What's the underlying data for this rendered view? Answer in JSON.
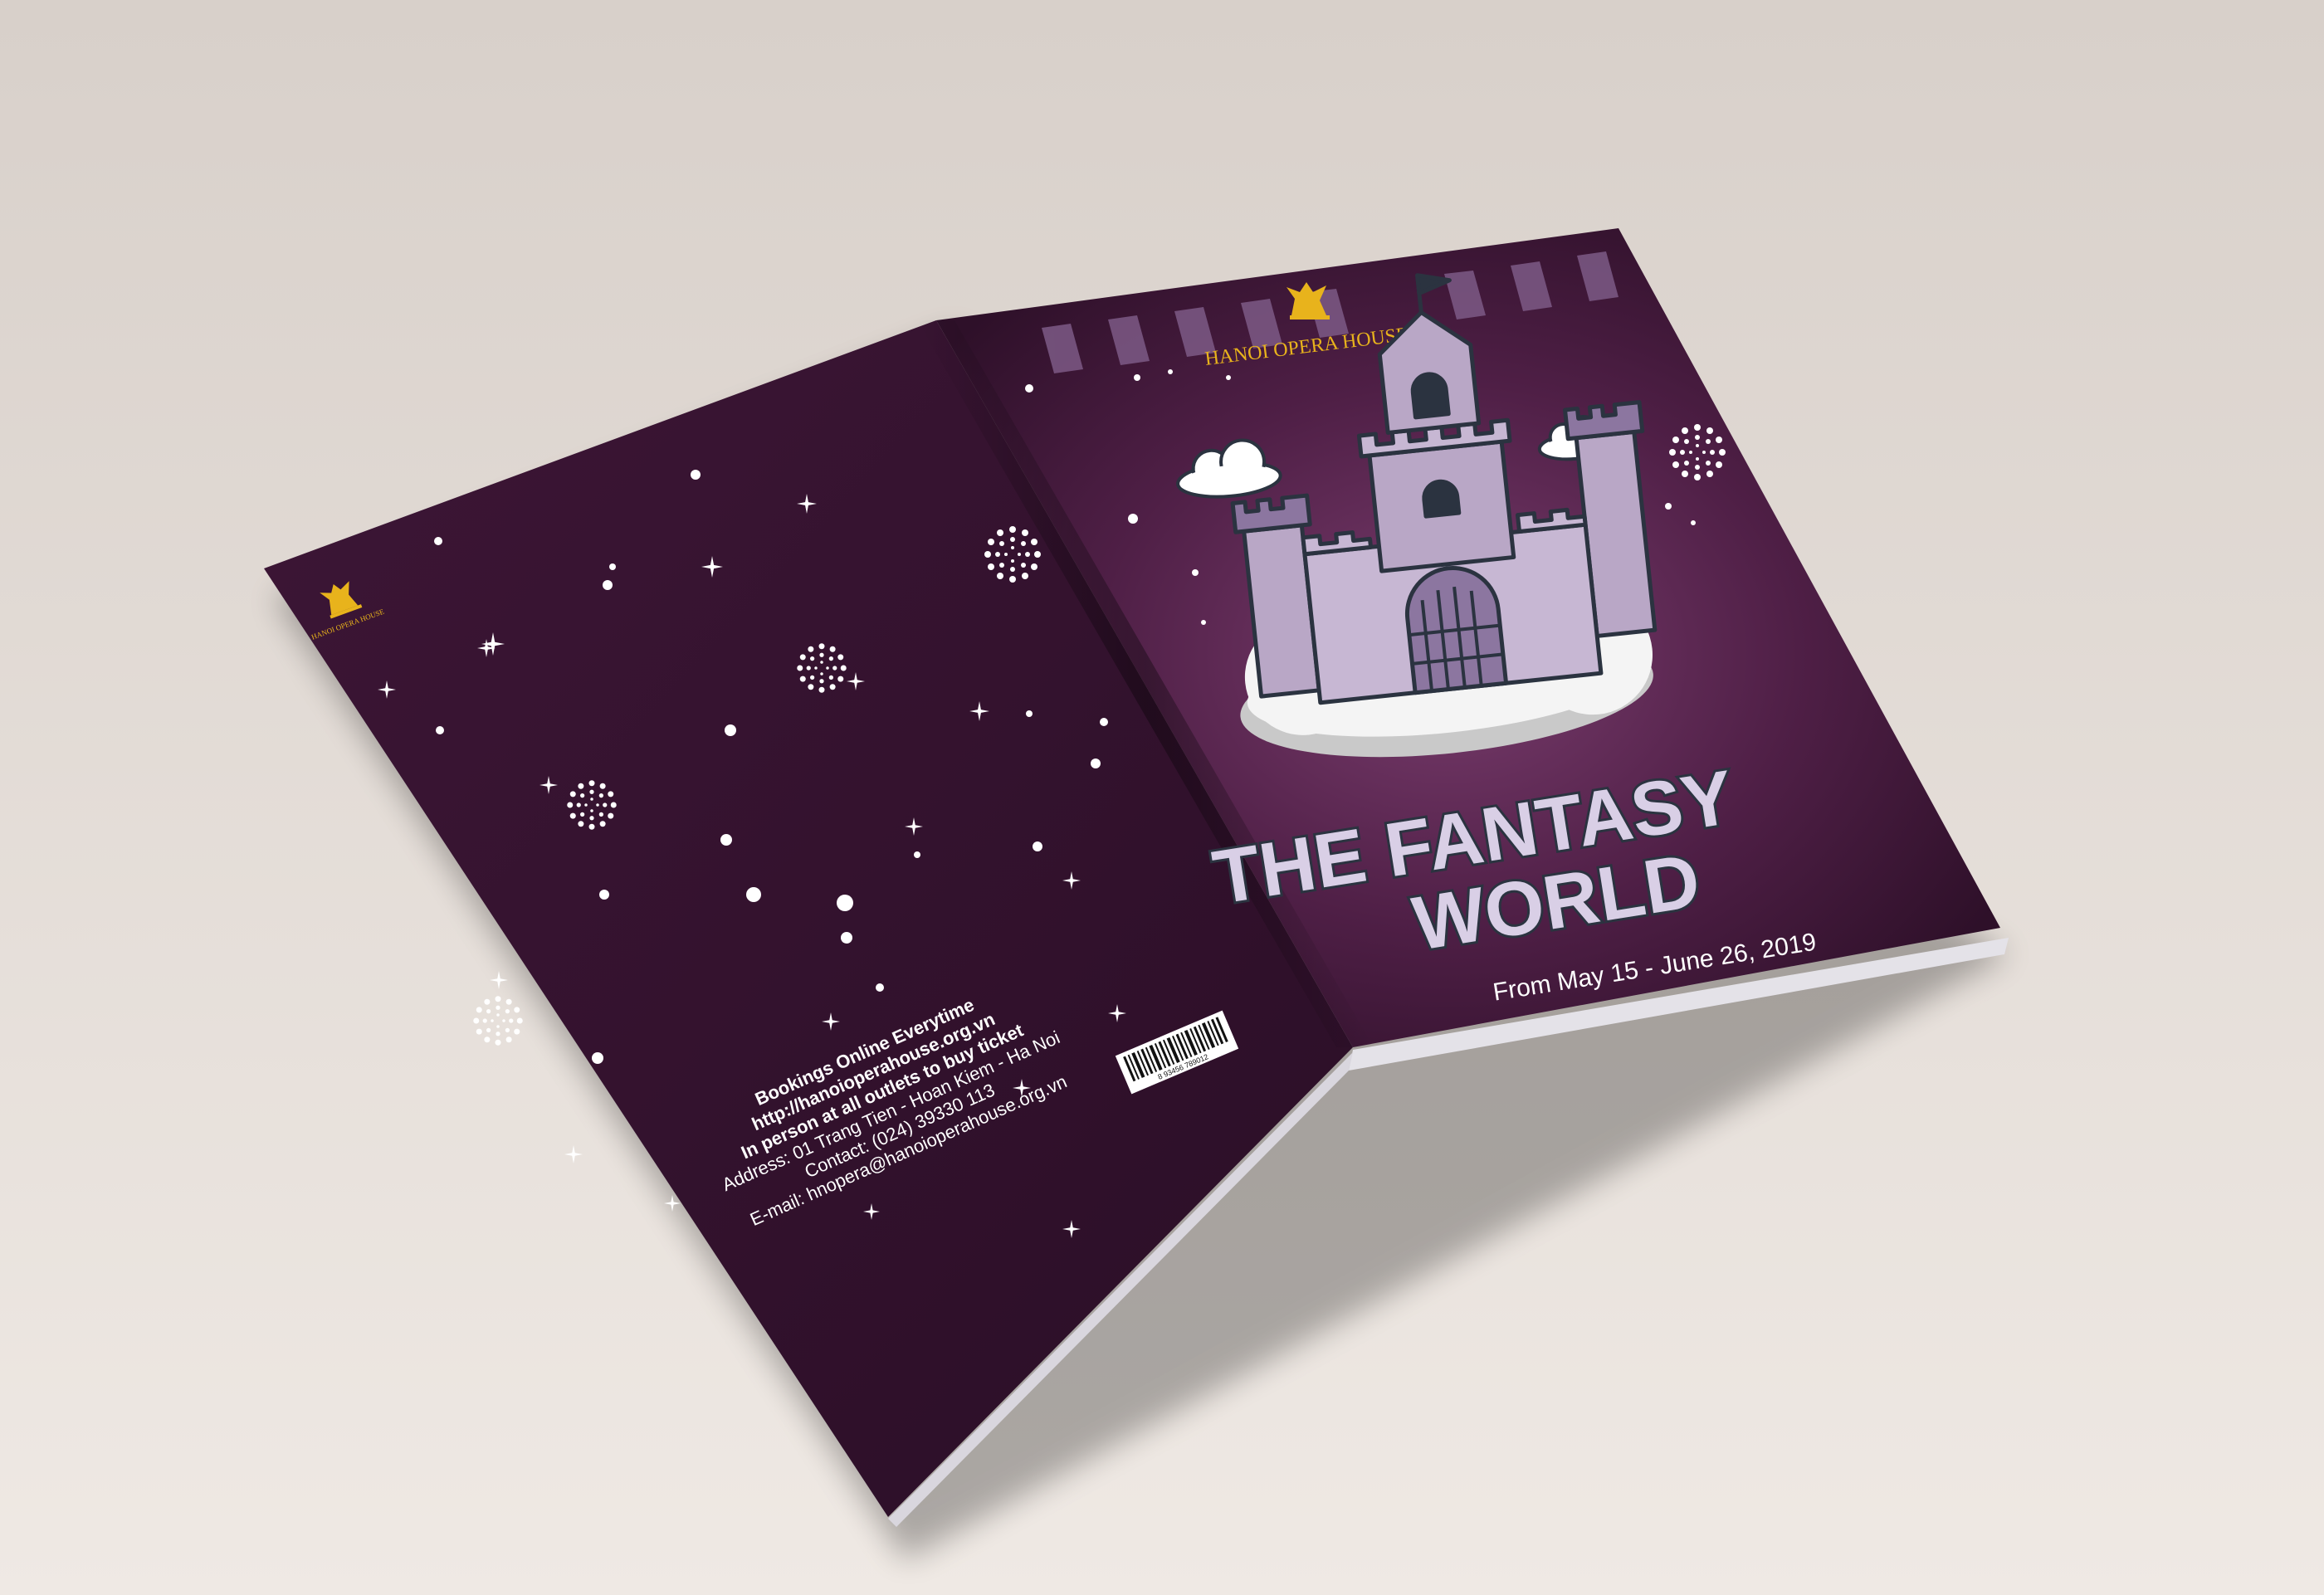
{
  "colors": {
    "background_top": "#d9d1cb",
    "background_bottom": "#efe9e4",
    "cover_dark": "#2a0f26",
    "cover_mid": "#55254c",
    "cover_glow": "#7a3d6e",
    "gold": "#e8b31c",
    "castle": "#b9a7c6",
    "castle_dark": "#8c76a0",
    "castle_outline": "#2b3340",
    "cloud": "#ffffff",
    "cloud_shadow": "#c9c9c9",
    "title_fill": "#d9cfe6"
  },
  "front_cover": {
    "publisher": "HANOI OPERA HOUSE",
    "logo_icon": "winged-lion-logo",
    "title_line1": "THE FANTASY",
    "title_line2": "WORLD",
    "dates": "From May 15 - June 26, 2019"
  },
  "back_cover": {
    "logo_icon": "winged-lion-logo",
    "logo_caption": "HANOI OPERA HOUSE",
    "barcode_icon": "barcode-icon",
    "barcode_digits": "8 93456 789012",
    "info": {
      "line1": "Bookings Online Everytime",
      "line2": "http://hanoioperahouse.org.vn",
      "line3": "In person at all outlets to buy ticket",
      "line4": "Address: 01 Trang Tien - Hoan Kiem - Ha Noi",
      "line5": "Contact: (024) 39330 113",
      "line6": "E-mail: hnopera@hanoioperahouse.org.vn"
    }
  }
}
